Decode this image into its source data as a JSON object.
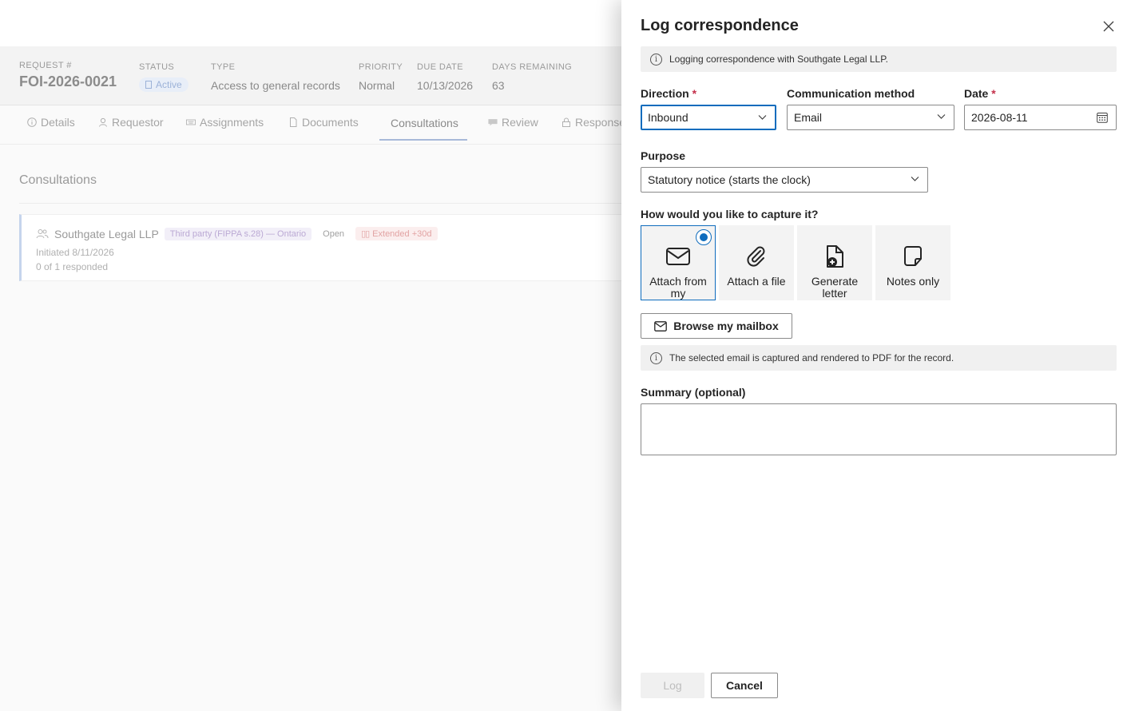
{
  "request_header": {
    "request_label": "REQUEST #",
    "request_number": "FOI-2026-0021",
    "status_label": "STATUS",
    "status_value": "Active",
    "type_label": "TYPE",
    "type_value": "Access to general records",
    "priority_label": "PRIORITY",
    "priority_value": "Normal",
    "due_label": "DUE DATE",
    "due_value": "10/13/2026",
    "days_label": "DAYS REMAINING",
    "days_value": "63"
  },
  "tabs": [
    {
      "label": "Details",
      "icon": "info-icon"
    },
    {
      "label": "Requestor",
      "icon": "person-icon"
    },
    {
      "label": "Assignments",
      "icon": "keyboard-icon"
    },
    {
      "label": "Documents",
      "icon": "document-icon"
    },
    {
      "label": "Consultations",
      "icon": ""
    },
    {
      "label": "Review",
      "icon": "comment-icon"
    },
    {
      "label": "Response",
      "icon": "lock-icon"
    }
  ],
  "active_tab": "Consultations",
  "consultations": {
    "title": "Consultations",
    "card": {
      "name": "Southgate Legal LLP",
      "type_badge": "Third party (FIPPA s.28) — Ontario",
      "state_badge": "Open",
      "extension_badge": "Extended +30d",
      "initiated": "Initiated 8/11/2026",
      "responded": "0 of 1 responded"
    }
  },
  "drawer": {
    "title": "Log correspondence",
    "info_text": "Logging correspondence with Southgate Legal LLP.",
    "direction_label": "Direction",
    "direction_value": "Inbound",
    "method_label": "Communication method",
    "method_value": "Email",
    "date_label": "Date",
    "date_value": "2026-08-11",
    "required_mark": "*",
    "purpose_label": "Purpose",
    "purpose_value": "Statutory notice (starts the clock)",
    "capture_label": "How would you like to capture it?",
    "capture_options": [
      {
        "label": "Attach from my",
        "icon": "mail-icon",
        "selected": true
      },
      {
        "label": "Attach a file",
        "icon": "paperclip-icon",
        "selected": false
      },
      {
        "label": "Generate letter",
        "icon": "document-add-icon",
        "selected": false
      },
      {
        "label": "Notes only",
        "icon": "note-icon",
        "selected": false
      }
    ],
    "browse_button": "Browse my mailbox",
    "capture_info": "The selected email is captured and rendered to PDF for the record.",
    "summary_label": "Summary (optional)",
    "summary_value": "",
    "log_button": "Log",
    "cancel_button": "Cancel",
    "accent_color": "#0f6cbd",
    "required_color": "#c4314b"
  }
}
